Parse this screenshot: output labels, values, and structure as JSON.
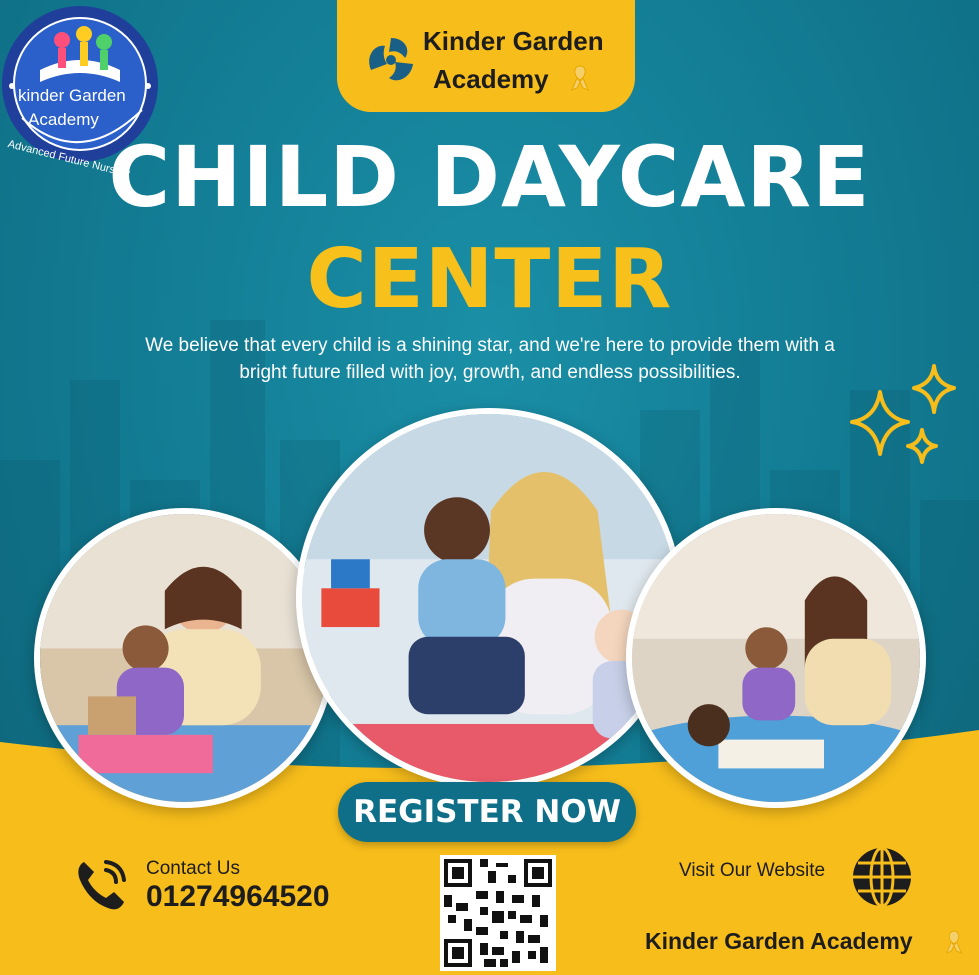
{
  "logo": {
    "line1": "kinder Garden",
    "line2": "Academy",
    "ring_text": "Advanced Future Nursery"
  },
  "brand_tab": {
    "line1": "Kinder Garden",
    "line2": "Academy"
  },
  "headline": {
    "line1": "CHILD DAYCARE",
    "line2": "CENTER"
  },
  "tagline": "We believe that every child is a shining star, and we're here to provide them with a bright future filled with joy, growth, and endless possibilities.",
  "cta": {
    "label": "REGISTER NOW"
  },
  "contact": {
    "label": "Contact Us",
    "phone": "01274964520"
  },
  "website": {
    "label": "Visit Our Website",
    "name": "Kinder Garden Academy"
  },
  "colors": {
    "teal": "#137e96",
    "yellow": "#f7bd1b",
    "white": "#ffffff",
    "dark": "#1d1d1d"
  },
  "icons": [
    "ribbon-icon",
    "phone-icon",
    "globe-icon",
    "sparkle-icon",
    "qr-code",
    "brand-swirl-icon"
  ]
}
